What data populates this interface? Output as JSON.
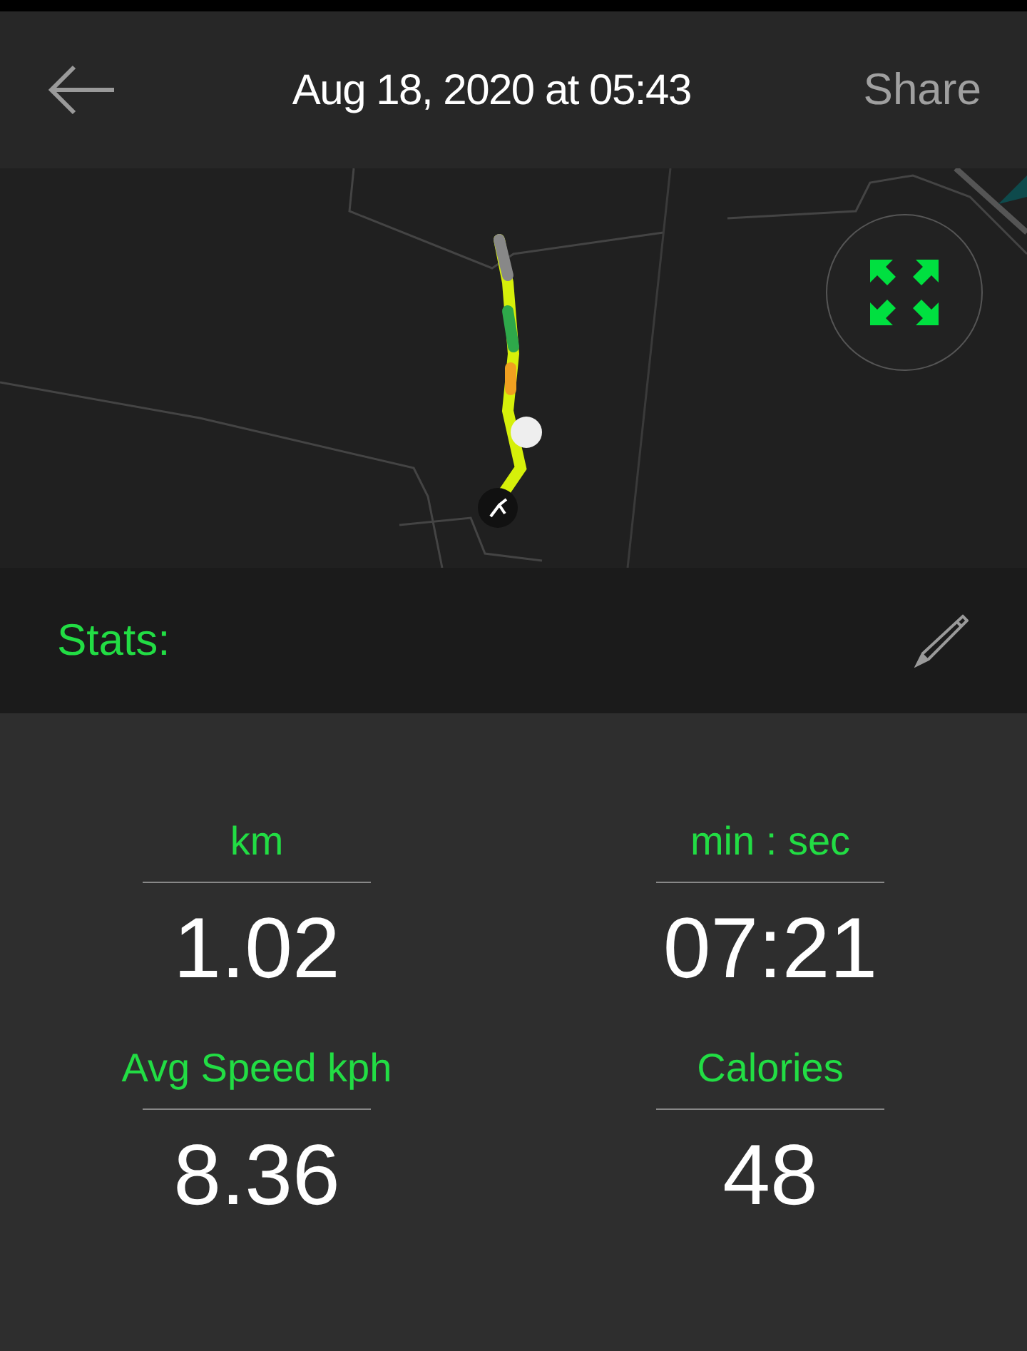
{
  "header": {
    "title": "Aug 18, 2020 at 05:43",
    "action": "Share"
  },
  "stats_bar": {
    "label": "Stats:"
  },
  "stats": [
    {
      "label": "km",
      "value": "1.02"
    },
    {
      "label": "min : sec",
      "value": "07:21"
    },
    {
      "label": "Avg Speed kph",
      "value": "8.36"
    },
    {
      "label": "Calories",
      "value": "48"
    }
  ]
}
